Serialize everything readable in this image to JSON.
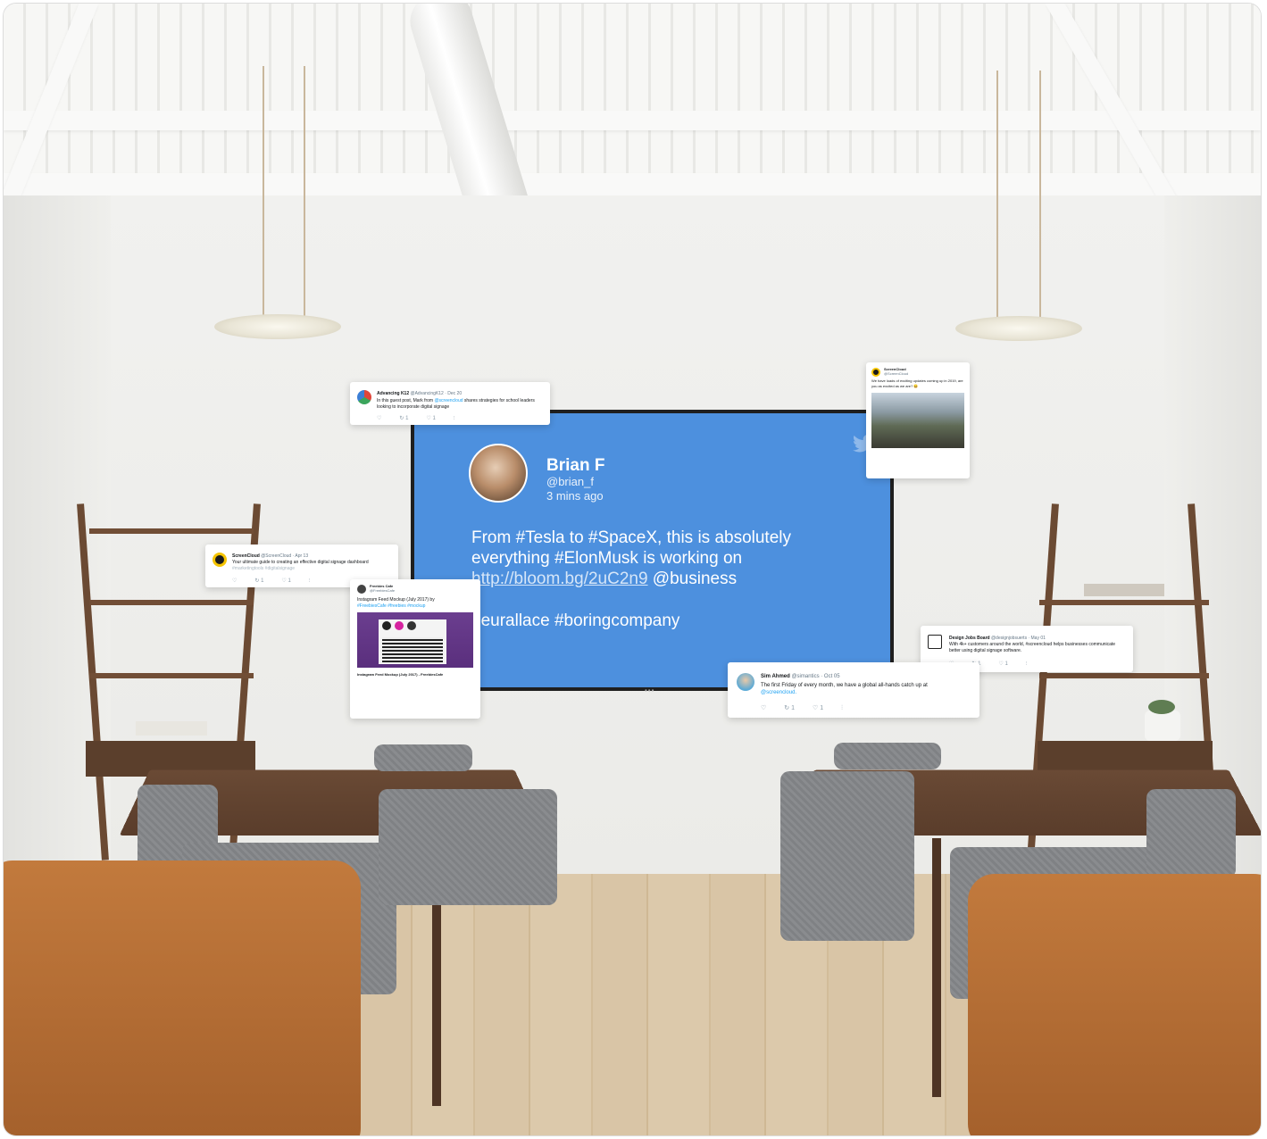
{
  "tv": {
    "name": "Brian F",
    "handle": "@brian_f",
    "time": "3 mins ago",
    "text_prefix": "From #Tesla to #SpaceX, this is absolutely everything #ElonMusk is working on ",
    "link": "http://bloom.bg/2uC2n9",
    "text_suffix": " @business",
    "tags": "neurallace #boringcompany",
    "dots": "•••"
  },
  "cards": {
    "advancing": {
      "name": "Advancing K12",
      "handle": "@AdvancingK12 · Dec 20",
      "text_a": "In this guest post, Mark from ",
      "mention": "@screencloud",
      "text_b": " shares strategies for school leaders looking to incorporate digital signage",
      "actions": {
        "reply": "♡",
        "retweet": "↻ 1",
        "like": "♡ 1",
        "stats": "⫶"
      }
    },
    "screencloud_apr": {
      "name": "ScreenCloud",
      "handle": "@ScreenCloud · Apr 13",
      "text": "Your ultimate guide to creating an effective digital signage dashboard",
      "tags": "#marketingtools #digitalsignage",
      "actions": {
        "reply": "♡",
        "retweet": "↻ 1",
        "like": "♡ 1",
        "stats": "⫶"
      }
    },
    "freebies": {
      "name": "Freebies Cafe",
      "handle": "@FreebiesCafe",
      "title": "Instagram Feed Mockup (July 2017) by",
      "tags": "#FreebiesCafe #freebies #mockup",
      "footer": "Instagram Feed Mockup (July 2017) - FreebiesCafe"
    },
    "screencloud_2019": {
      "name": "ScreenCloud",
      "handle": "@ScreenCloud",
      "text": "We have loads of exciting updates coming up in 2019, are you as excited as we are? 😀"
    },
    "designjobs": {
      "name": "Design Jobs Board",
      "handle": "@designjobsuerts · May 01",
      "text": "With 4k+ customers around the world, #screencloud helps businesses communicate better using digital signage software.",
      "actions": {
        "reply": "♡",
        "retweet": "↻ 1",
        "like": "♡ 1",
        "stats": "⫶"
      }
    },
    "sim": {
      "name": "Sim Ahmed",
      "handle": "@simantics · Oct 05",
      "text": "The first Friday of every month, we have a global all-hands catch up at",
      "mention": "@screencloud.",
      "actions": {
        "reply": "♡",
        "retweet": "↻ 1",
        "like": "♡ 1",
        "stats": "⫶"
      }
    }
  },
  "colors": {
    "tv_screen": "#4d90de",
    "twitter_blue": "#1da1f2",
    "wood": "#5a3d2b",
    "leather": "#b06a33"
  }
}
